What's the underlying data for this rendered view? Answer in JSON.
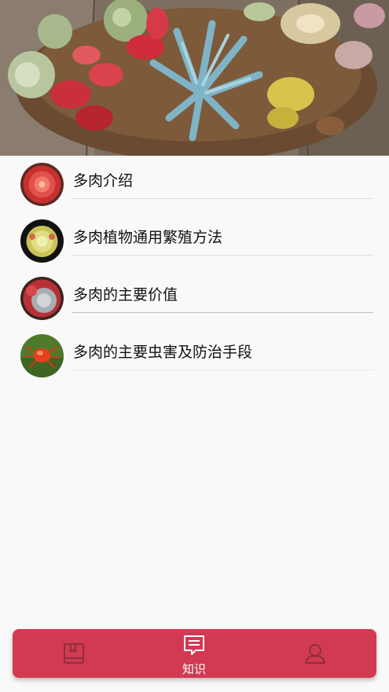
{
  "colors": {
    "accent": "#d13a51",
    "tab_inactive_icon": "#8e2f3c",
    "tab_active": "#ffffff",
    "background": "#f9f9f9",
    "divider": "#dcdcdc"
  },
  "list": {
    "items": [
      {
        "label": "多肉介绍",
        "icon": "red-succulent-thumbnail"
      },
      {
        "label": "多肉植物通用繁殖方法",
        "icon": "yellow-succulent-thumbnail"
      },
      {
        "label": "多肉的主要价值",
        "icon": "red-grey-succulent-thumbnail"
      },
      {
        "label": "多肉的主要虫害及防治手段",
        "icon": "red-spider-mite-thumbnail"
      }
    ]
  },
  "tabbar": {
    "tabs": [
      {
        "icon": "book-icon",
        "label": "",
        "active": false
      },
      {
        "icon": "message-icon",
        "label": "知识",
        "active": true
      },
      {
        "icon": "person-icon",
        "label": "",
        "active": false
      }
    ]
  }
}
